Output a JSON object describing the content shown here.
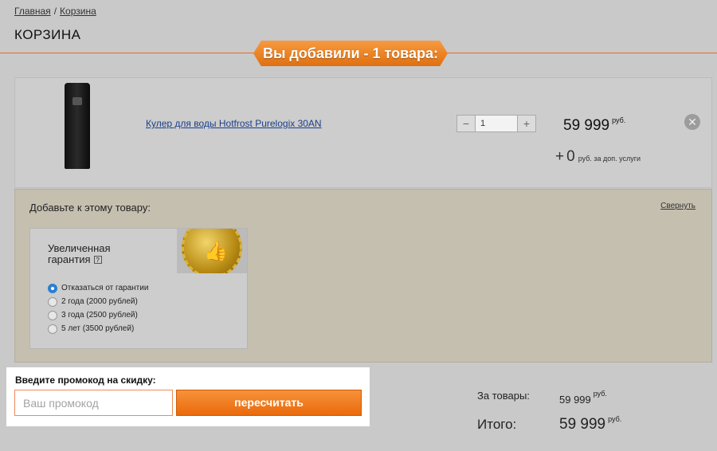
{
  "breadcrumb": {
    "home": "Главная",
    "separator": "/",
    "current": "Корзина"
  },
  "page_title": "КОРЗИНА",
  "banner": "Вы добавили - 1 товара:",
  "cart_item": {
    "name": "Кулер для воды Hotfrost Purelogix 30AN",
    "quantity": "1",
    "qty_minus": "−",
    "qty_plus": "+",
    "price": "59 999",
    "currency": "руб.",
    "extra_plus": "+",
    "extra_value": "0",
    "extra_text": "руб. за доп. услуги",
    "remove_symbol": "✕"
  },
  "addons": {
    "title": "Добавьте к этому товару:",
    "collapse_label": "Свернуть",
    "warranty": {
      "title_line1": "Увеличенная",
      "title_line2": "гарантия",
      "help": "?",
      "options": [
        {
          "label": "Отказаться от гарантии",
          "selected": true
        },
        {
          "label": "2 года (2000 рублей)",
          "selected": false
        },
        {
          "label": "3 года (2500 рублей)",
          "selected": false
        },
        {
          "label": "5 лет (3500 рублей)",
          "selected": false
        }
      ]
    }
  },
  "promo": {
    "label": "Введите промокод на скидку:",
    "placeholder": "Ваш промокод",
    "button": "пересчитать"
  },
  "totals": {
    "goods_label": "За товары:",
    "goods_value": "59 999",
    "total_label": "Итого:",
    "total_value": "59 999",
    "currency": "руб."
  },
  "colors": {
    "accent": "#ea6a0b",
    "link": "#1b3f8a",
    "radio_selected": "#2b7fd3"
  }
}
